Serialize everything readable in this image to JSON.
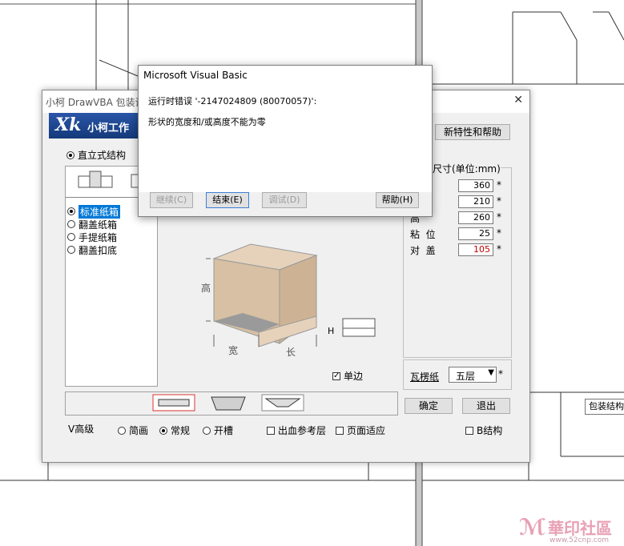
{
  "error_dialog": {
    "title": "Microsoft Visual Basic",
    "line1": "运行时错误 '-2147024809 (80070057)':",
    "line2": "形状的宽度和/或高度不能为零",
    "buttons": {
      "continue": "继续(C)",
      "end": "结束(E)",
      "debug": "调试(D)",
      "help": "帮助(H)"
    }
  },
  "main_dialog": {
    "title": "小柯 DrawVBA 包装设",
    "logo": "Xk",
    "brand": "小柯工作",
    "whats_new_button": "新特性和帮助",
    "structure_radio": "直立式结构",
    "box_types": [
      "标准纸箱",
      "翻盖纸箱",
      "手提纸箱",
      "翻盖扣底"
    ],
    "selected_box_index": 0,
    "preview_labels": {
      "height": "高",
      "width": "宽",
      "length": "长",
      "h": "H"
    },
    "single_flap_label": "单边",
    "single_flap_checked": true,
    "dimensions": {
      "header": "尺寸(单位:mm)",
      "rows": [
        {
          "label": "",
          "value": "360",
          "star": "*"
        },
        {
          "label": "",
          "value": "210",
          "star": "*"
        },
        {
          "label": "高",
          "value": "260",
          "star": "*"
        },
        {
          "label": "粘  位",
          "value": "25",
          "star": "*"
        },
        {
          "label": "对  盖",
          "value": "105",
          "star": "*"
        }
      ],
      "highlight_color": "#c00000"
    },
    "corrugated": {
      "label": "瓦楞纸",
      "value": "五层",
      "star": "*"
    },
    "ok_button": "确定",
    "exit_button": "退出",
    "advanced_label": "V高级",
    "mode_options": [
      {
        "label": "简画",
        "on": false
      },
      {
        "label": "常规",
        "on": true
      },
      {
        "label": "开槽",
        "on": false
      }
    ],
    "checkboxes": [
      {
        "label": "出血参考层",
        "checked": false
      },
      {
        "label": "页面适应",
        "checked": false
      },
      {
        "label": "B结构",
        "checked": false
      }
    ]
  },
  "tooltip": "包装结构",
  "watermark": {
    "text": "華印社區",
    "url": "www.52cnp.com"
  }
}
